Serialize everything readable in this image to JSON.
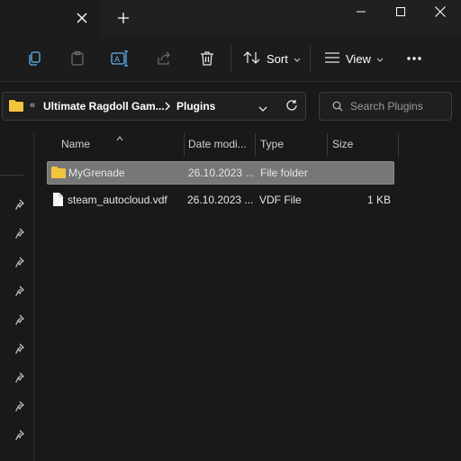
{
  "window": {
    "tab_close_icon": "close-icon",
    "new_tab_icon": "plus-icon"
  },
  "toolbar": {
    "sort_label": "Sort",
    "view_label": "View"
  },
  "address": {
    "overflow": "«",
    "crumbs": [
      "Ultimate Ragdoll Gam...",
      "Plugins"
    ]
  },
  "search": {
    "placeholder": "Search Plugins"
  },
  "columns": {
    "name": "Name",
    "date": "Date modi...",
    "type": "Type",
    "size": "Size"
  },
  "files": [
    {
      "name": "MyGrenade",
      "date": "26.10.2023 ...",
      "type": "File folder",
      "size": "",
      "icon": "folder-icon",
      "selected": true
    },
    {
      "name": "steam_autocloud.vdf",
      "date": "26.10.2023 ...",
      "type": "VDF File",
      "size": "1 KB",
      "icon": "file-icon",
      "selected": false
    }
  ],
  "colors": {
    "folder": "#f2c53d",
    "selection": "#777777",
    "background": "#191919"
  }
}
